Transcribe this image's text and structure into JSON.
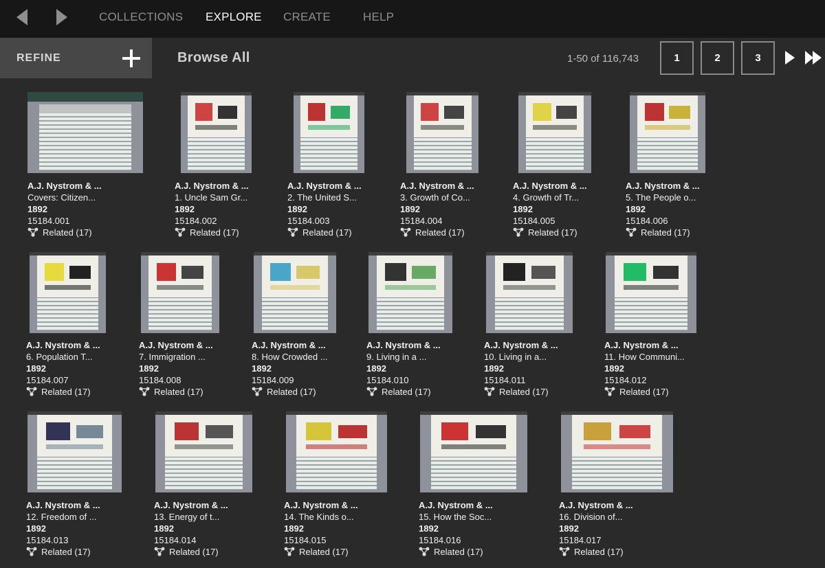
{
  "nav": {
    "back_icon": "triangle-left-icon",
    "forward_icon": "triangle-right-icon",
    "items": [
      {
        "label": "COLLECTIONS",
        "active": false
      },
      {
        "label": "EXPLORE",
        "active": true
      },
      {
        "label": "CREATE",
        "active": false
      },
      {
        "label": "HELP",
        "active": false
      }
    ]
  },
  "toolbar": {
    "refine_label": "REFINE",
    "refine_icon": "plus-icon",
    "browse_title": "Browse All",
    "result_count": "1-50 of 116,743",
    "pages": [
      "1",
      "2",
      "3"
    ],
    "next_icon": "triangle-right-icon",
    "last_icon": "double-triangle-right-icon"
  },
  "colors": {
    "nav_bg": "#171717",
    "page_bg": "#2a2a2a",
    "refine_bg": "#474747",
    "active_nav": "#ffffff",
    "inactive_nav": "#8e8e8e"
  },
  "items": [
    {
      "publisher": "A.J. Nystrom & ...",
      "title": "Covers: Citizen...",
      "date": "1892",
      "accession": "15184.001",
      "related": "Related (17)"
    },
    {
      "publisher": "A.J. Nystrom & ...",
      "title": "1. Uncle Sam Gr...",
      "date": "1892",
      "accession": "15184.002",
      "related": "Related (17)"
    },
    {
      "publisher": "A.J. Nystrom & ...",
      "title": "2. The United S...",
      "date": "1892",
      "accession": "15184.003",
      "related": "Related (17)"
    },
    {
      "publisher": "A.J. Nystrom & ...",
      "title": "3. Growth of Co...",
      "date": "1892",
      "accession": "15184.004",
      "related": "Related (17)"
    },
    {
      "publisher": "A.J. Nystrom & ...",
      "title": "4. Growth of Tr...",
      "date": "1892",
      "accession": "15184.005",
      "related": "Related (17)"
    },
    {
      "publisher": "A.J. Nystrom & ...",
      "title": "5. The People o...",
      "date": "1892",
      "accession": "15184.006",
      "related": "Related (17)"
    },
    {
      "publisher": "A.J. Nystrom & ...",
      "title": "6. Population T...",
      "date": "1892",
      "accession": "15184.007",
      "related": "Related (17)"
    },
    {
      "publisher": "A.J. Nystrom & ...",
      "title": "7. Immigration ...",
      "date": "1892",
      "accession": "15184.008",
      "related": "Related (17)"
    },
    {
      "publisher": "A.J. Nystrom & ...",
      "title": "8. How Crowded ...",
      "date": "1892",
      "accession": "15184.009",
      "related": "Related (17)"
    },
    {
      "publisher": "A.J. Nystrom & ...",
      "title": "9. Living in a ...",
      "date": "1892",
      "accession": "15184.010",
      "related": "Related (17)"
    },
    {
      "publisher": "A.J. Nystrom & ...",
      "title": "10. Living in a...",
      "date": "1892",
      "accession": "15184.011",
      "related": "Related (17)"
    },
    {
      "publisher": "A.J. Nystrom & ...",
      "title": "11. How Communi...",
      "date": "1892",
      "accession": "15184.012",
      "related": "Related (17)"
    },
    {
      "publisher": "A.J. Nystrom & ...",
      "title": "12. Freedom of ...",
      "date": "1892",
      "accession": "15184.013",
      "related": "Related (17)"
    },
    {
      "publisher": "A.J. Nystrom & ...",
      "title": "13. Energy of t...",
      "date": "1892",
      "accession": "15184.014",
      "related": "Related (17)"
    },
    {
      "publisher": "A.J. Nystrom & ...",
      "title": "14. The Kinds o...",
      "date": "1892",
      "accession": "15184.015",
      "related": "Related (17)"
    },
    {
      "publisher": "A.J. Nystrom & ...",
      "title": "15. How the Soc...",
      "date": "1892",
      "accession": "15184.016",
      "related": "Related (17)"
    },
    {
      "publisher": "A.J. Nystrom & ...",
      "title": "16. Division of...",
      "date": "1892",
      "accession": "15184.017",
      "related": "Related (17)"
    }
  ]
}
